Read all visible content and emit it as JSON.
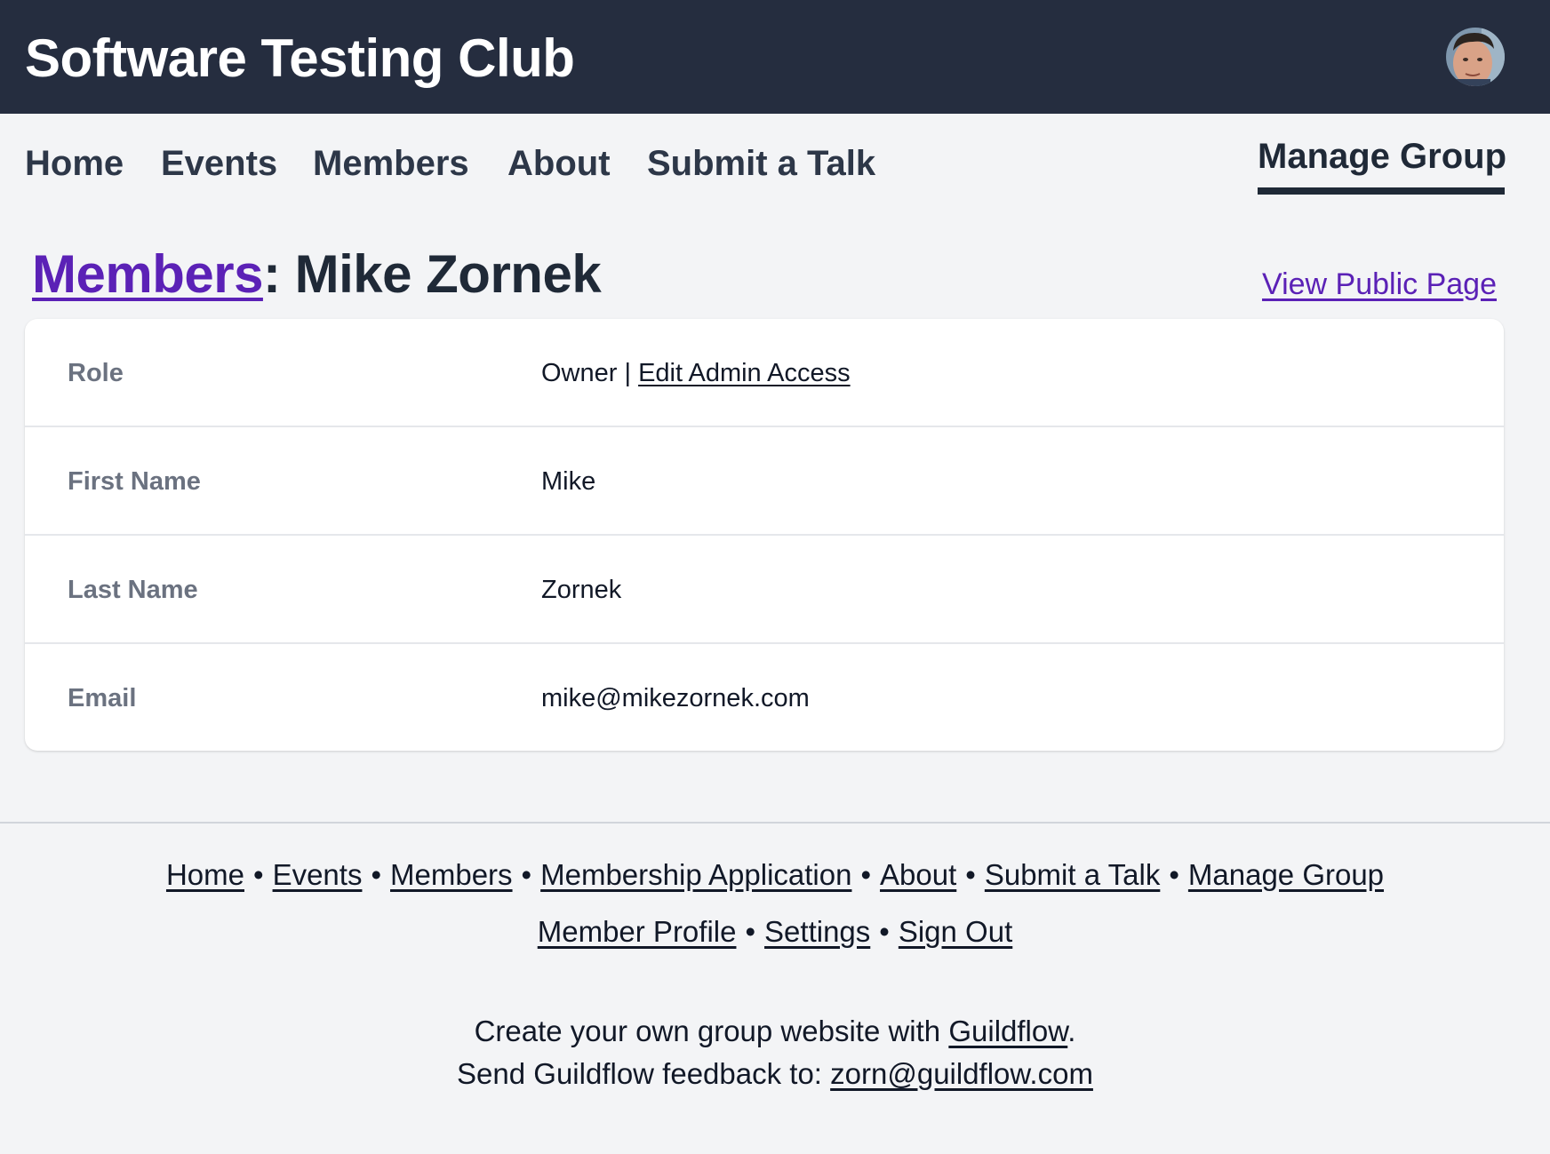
{
  "header": {
    "site_title": "Software Testing Club",
    "avatar_icon": "user-avatar-photo"
  },
  "nav": {
    "home": "Home",
    "events": "Events",
    "members": "Members",
    "about": "About",
    "submit_talk": "Submit a Talk",
    "manage_group": "Manage Group"
  },
  "page": {
    "breadcrumb": "Members",
    "separator": ": ",
    "title": "Mike Zornek",
    "view_public": "View Public Page"
  },
  "details": {
    "role_label": "Role",
    "role_value": "Owner | ",
    "role_edit_link": "Edit Admin Access",
    "first_name_label": "First Name",
    "first_name_value": "Mike",
    "last_name_label": "Last Name",
    "last_name_value": "Zornek",
    "email_label": "Email",
    "email_value": "mike@mikezornek.com"
  },
  "footer": {
    "links_row1": [
      "Home",
      "Events",
      "Members",
      "Membership Application",
      "About",
      "Submit a Talk",
      "Manage Group"
    ],
    "links_row2": [
      "Member Profile",
      "Settings",
      "Sign Out"
    ],
    "separator": "•",
    "create_prefix": "Create your own group website with ",
    "create_link": "Guildflow",
    "create_suffix": ".",
    "feedback_prefix": "Send Guildflow feedback to: ",
    "feedback_link": "zorn@guildflow.com"
  },
  "colors": {
    "header_bg": "#252d3f",
    "accent_purple": "#5b21b6",
    "page_bg": "#f3f4f6"
  }
}
